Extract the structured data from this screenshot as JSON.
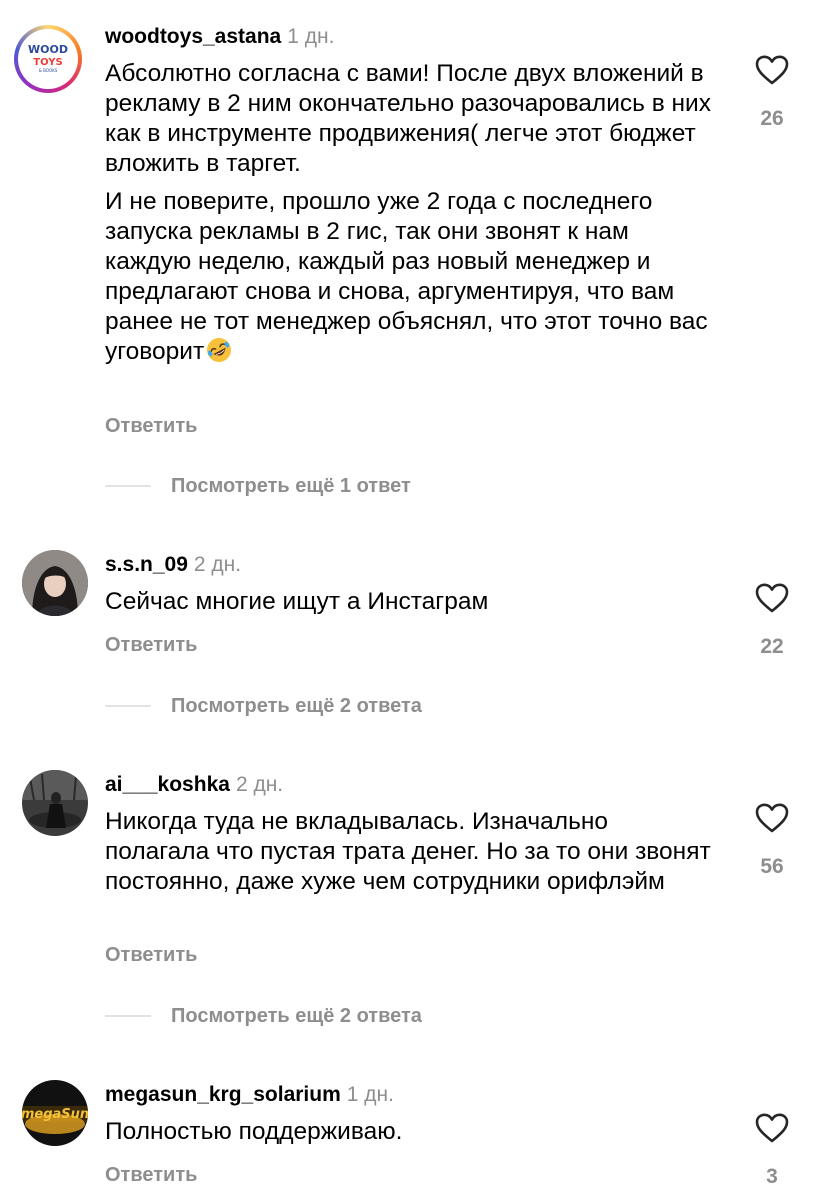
{
  "comments": [
    {
      "username": "woodtoys_astana",
      "time": "1 дн.",
      "paragraphs": [
        "Абсолютно согласна с вами! После двух вложений в рекламу в 2 ним окончательно разочаровались в них как в инструменте продвижения( легче этот бюджет вложить в таргет.",
        "И не поверите, прошло уже 2 года с последнего запуска рекламы в 2 гис, так они звонят к нам каждую неделю, каждый раз новый менеджер и предлагают снова и снова, аргументируя, что вам ранее не тот менеджер объяснял, что этот точно вас уговорит"
      ],
      "emoji": "rolling-on-floor-laughing",
      "likes": "26",
      "reply_label": "Ответить",
      "more_replies": "Посмотреть ещё 1 ответ",
      "avatar_logo": {
        "line1": "WOOD",
        "line2": "TOYS",
        "line3": "& BOOKS"
      }
    },
    {
      "username": "s.s.n_09",
      "time": "2 дн.",
      "paragraphs": [
        "Сейчас многие ищут а Инстаграм"
      ],
      "likes": "22",
      "reply_label": "Ответить",
      "more_replies": "Посмотреть ещё 2 ответа"
    },
    {
      "username": "ai___koshka",
      "time": "2 дн.",
      "paragraphs": [
        "Никогда туда не вкладывалась. Изначально полагала что пустая трата денег. Но за то они звонят постоянно, даже хуже чем сотрудники орифлэйм"
      ],
      "likes": "56",
      "reply_label": "Ответить",
      "more_replies": "Посмотреть ещё 2 ответа"
    },
    {
      "username": "megasun_krg_solarium",
      "time": "1 дн.",
      "paragraphs": [
        "Полностью поддерживаю."
      ],
      "likes": "3",
      "reply_label": "Ответить",
      "avatar_logo": {
        "text": "megaSun"
      }
    }
  ],
  "colors": {
    "text": "#000000",
    "secondary": "#8e8e8e",
    "divider": "#e2e2e2",
    "story_ring_start": "#feda75",
    "story_ring_mid": "#d62976",
    "story_ring_end": "#962fbf"
  }
}
